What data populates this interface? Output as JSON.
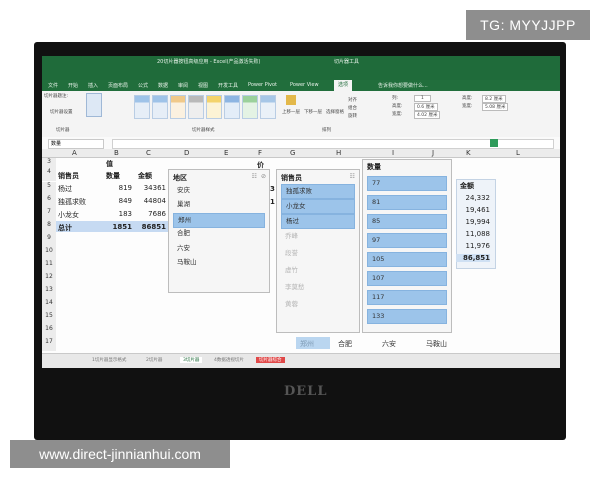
{
  "watermarks": {
    "top": "TG: MYYJJPP",
    "bottom": "www.direct-jinnianhui.com"
  },
  "laptop_logo": "DELL",
  "window": {
    "title": "20切片器按钮高级应用 - Excel(产品激活失败)",
    "context_tab_group": "切片器工具"
  },
  "menu": {
    "tabs": [
      "文件",
      "开始",
      "插入",
      "页面布局",
      "公式",
      "数据",
      "审阅",
      "视图",
      "开发工具",
      "Power Pivot",
      "Power View",
      "选项"
    ],
    "tell_me": "告诉我你想要做什么..."
  },
  "ribbon": {
    "slicer_caption": "切片器题注:",
    "slicer_settings": "切片器设置",
    "group_slicer": "切片器",
    "group_styles": "切片器样式",
    "group_arrange": "排列",
    "columns_label": "列:",
    "columns_value": "1",
    "height_label": "高度:",
    "height_value": "0.6 厘米",
    "width_label": "宽度:",
    "width_value": "4.02 厘米",
    "size_height": "8.2 厘米",
    "size_width": "5.08 厘米",
    "arrange_items": [
      "上移一层",
      "下移一层",
      "选择窗格",
      "对齐",
      "组合",
      "旋转"
    ]
  },
  "name_box": "数量",
  "columns": [
    "A",
    "B",
    "C",
    "D",
    "E",
    "F",
    "G",
    "H",
    "I",
    "J",
    "K",
    "L"
  ],
  "rows": [
    "3",
    "4",
    "5",
    "6",
    "7",
    "8",
    "9",
    "10",
    "11",
    "12",
    "13",
    "14",
    "15",
    "16",
    "17"
  ],
  "pivot": {
    "header_value": "值",
    "col_salesperson": "销售员",
    "col_qty": "数量",
    "col_amount": "金额",
    "data": [
      {
        "name": "杨过",
        "qty": "819",
        "amount": "34361"
      },
      {
        "name": "独孤求败",
        "qty": "849",
        "amount": "44804"
      },
      {
        "name": "小龙女",
        "qty": "183",
        "amount": "7686"
      }
    ],
    "total": {
      "name": "总计",
      "qty": "1851",
      "amount": "86851"
    }
  },
  "slicer_region": {
    "title": "地区",
    "items": [
      "安庆",
      "巢湖",
      "郑州",
      "合肥",
      "六安",
      "马鞍山"
    ],
    "selected": [
      "郑州"
    ]
  },
  "slicer_salesperson": {
    "title": "销售员",
    "items": [
      "独孤求败",
      "小龙女",
      "杨过",
      "乔峰",
      "段誉",
      "虚竹",
      "李莫愁",
      "黄蓉"
    ],
    "selected": [
      "独孤求败",
      "小龙女",
      "杨过"
    ]
  },
  "slicer_qty": {
    "title": "数量",
    "items": [
      "77",
      "81",
      "85",
      "97",
      "105",
      "107",
      "117",
      "133"
    ]
  },
  "amount_col": {
    "header": "金额",
    "values": [
      "24,332",
      "19,461",
      "19,994",
      "11,088",
      "11,976"
    ],
    "total": "86,851"
  },
  "stray": {
    "f_row3": "价",
    "f_row5": "3",
    "f_row6": "1"
  },
  "bottom_row_labels": [
    "郑州",
    "合肥",
    "六安",
    "马鞍山"
  ],
  "sheet_tabs": [
    "1切片器显示格式",
    "2切片器",
    "3切片器",
    "4数据透视切片",
    "切片器综合"
  ]
}
